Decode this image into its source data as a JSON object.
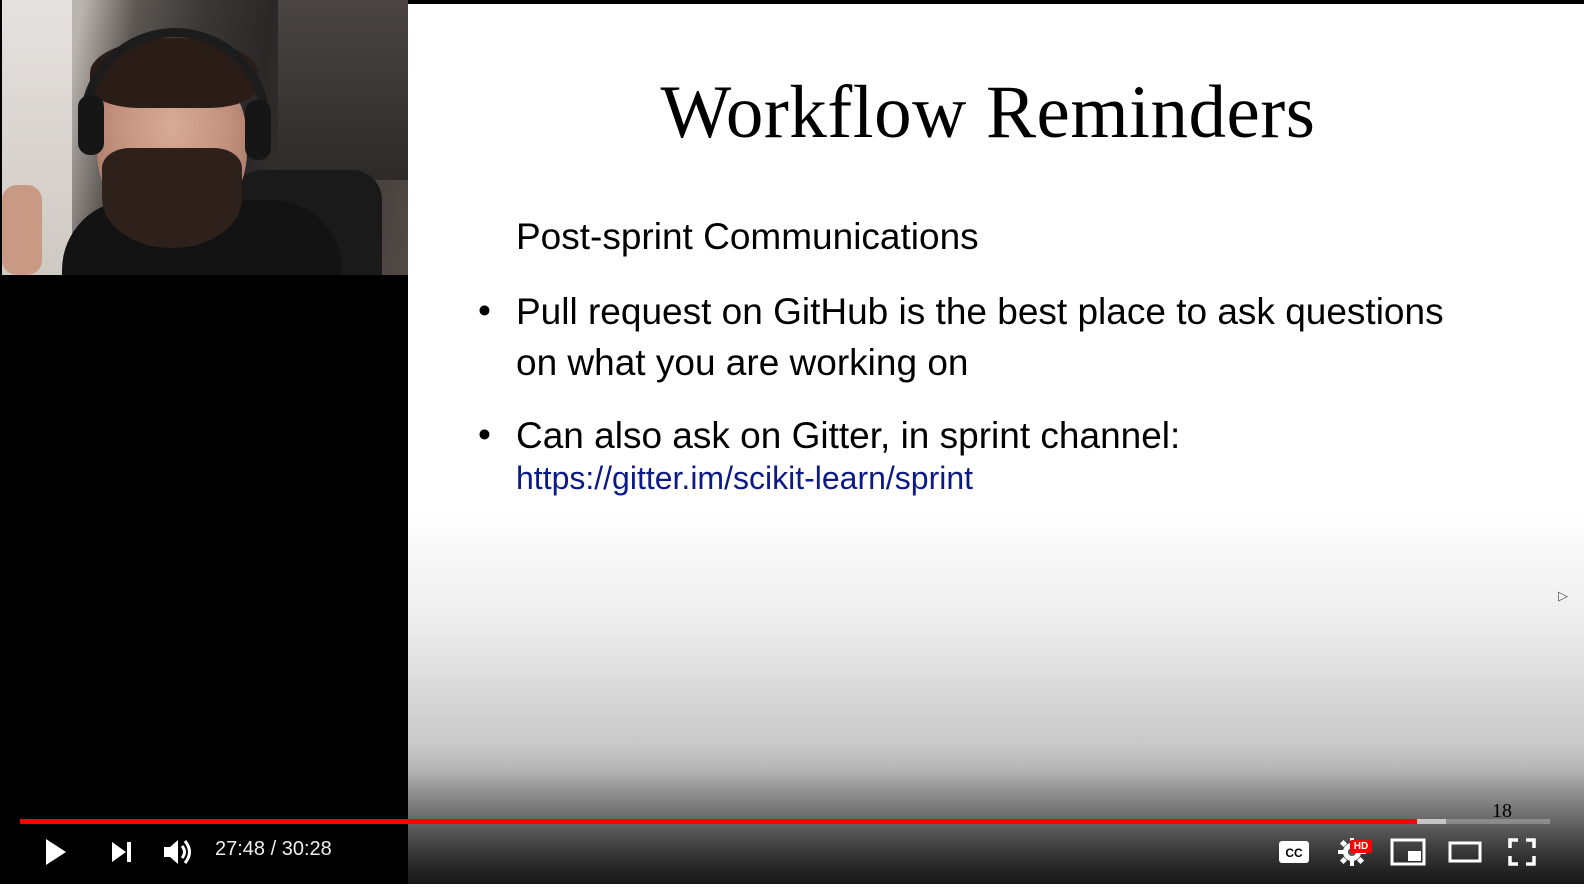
{
  "slide": {
    "title": "Workflow Reminders",
    "subheading": "Post-sprint Communications",
    "bullets": [
      {
        "line1": "Pull request on GitHub is the best place to ask questions",
        "line2": "on what you are working on"
      },
      {
        "line1": "Can also ask on Gitter, in sprint channel:"
      }
    ],
    "link": "https://gitter.im/scikit-learn/sprint",
    "page_number": "18"
  },
  "player": {
    "time_display": "27:48 / 30:28",
    "current_time": "27:48",
    "duration": "30:28",
    "progress_fraction": 0.913,
    "buffered_fraction": 0.932,
    "hd_badge": "HD",
    "cc_label": "CC",
    "colors": {
      "progress": "#ff0000",
      "hd_badge": "#ff0000",
      "link": "#0b1a86"
    },
    "icons": [
      "play-icon",
      "next-icon",
      "volume-icon",
      "cc-icon",
      "settings-icon",
      "miniplayer-icon",
      "theater-icon",
      "fullscreen-icon"
    ]
  }
}
